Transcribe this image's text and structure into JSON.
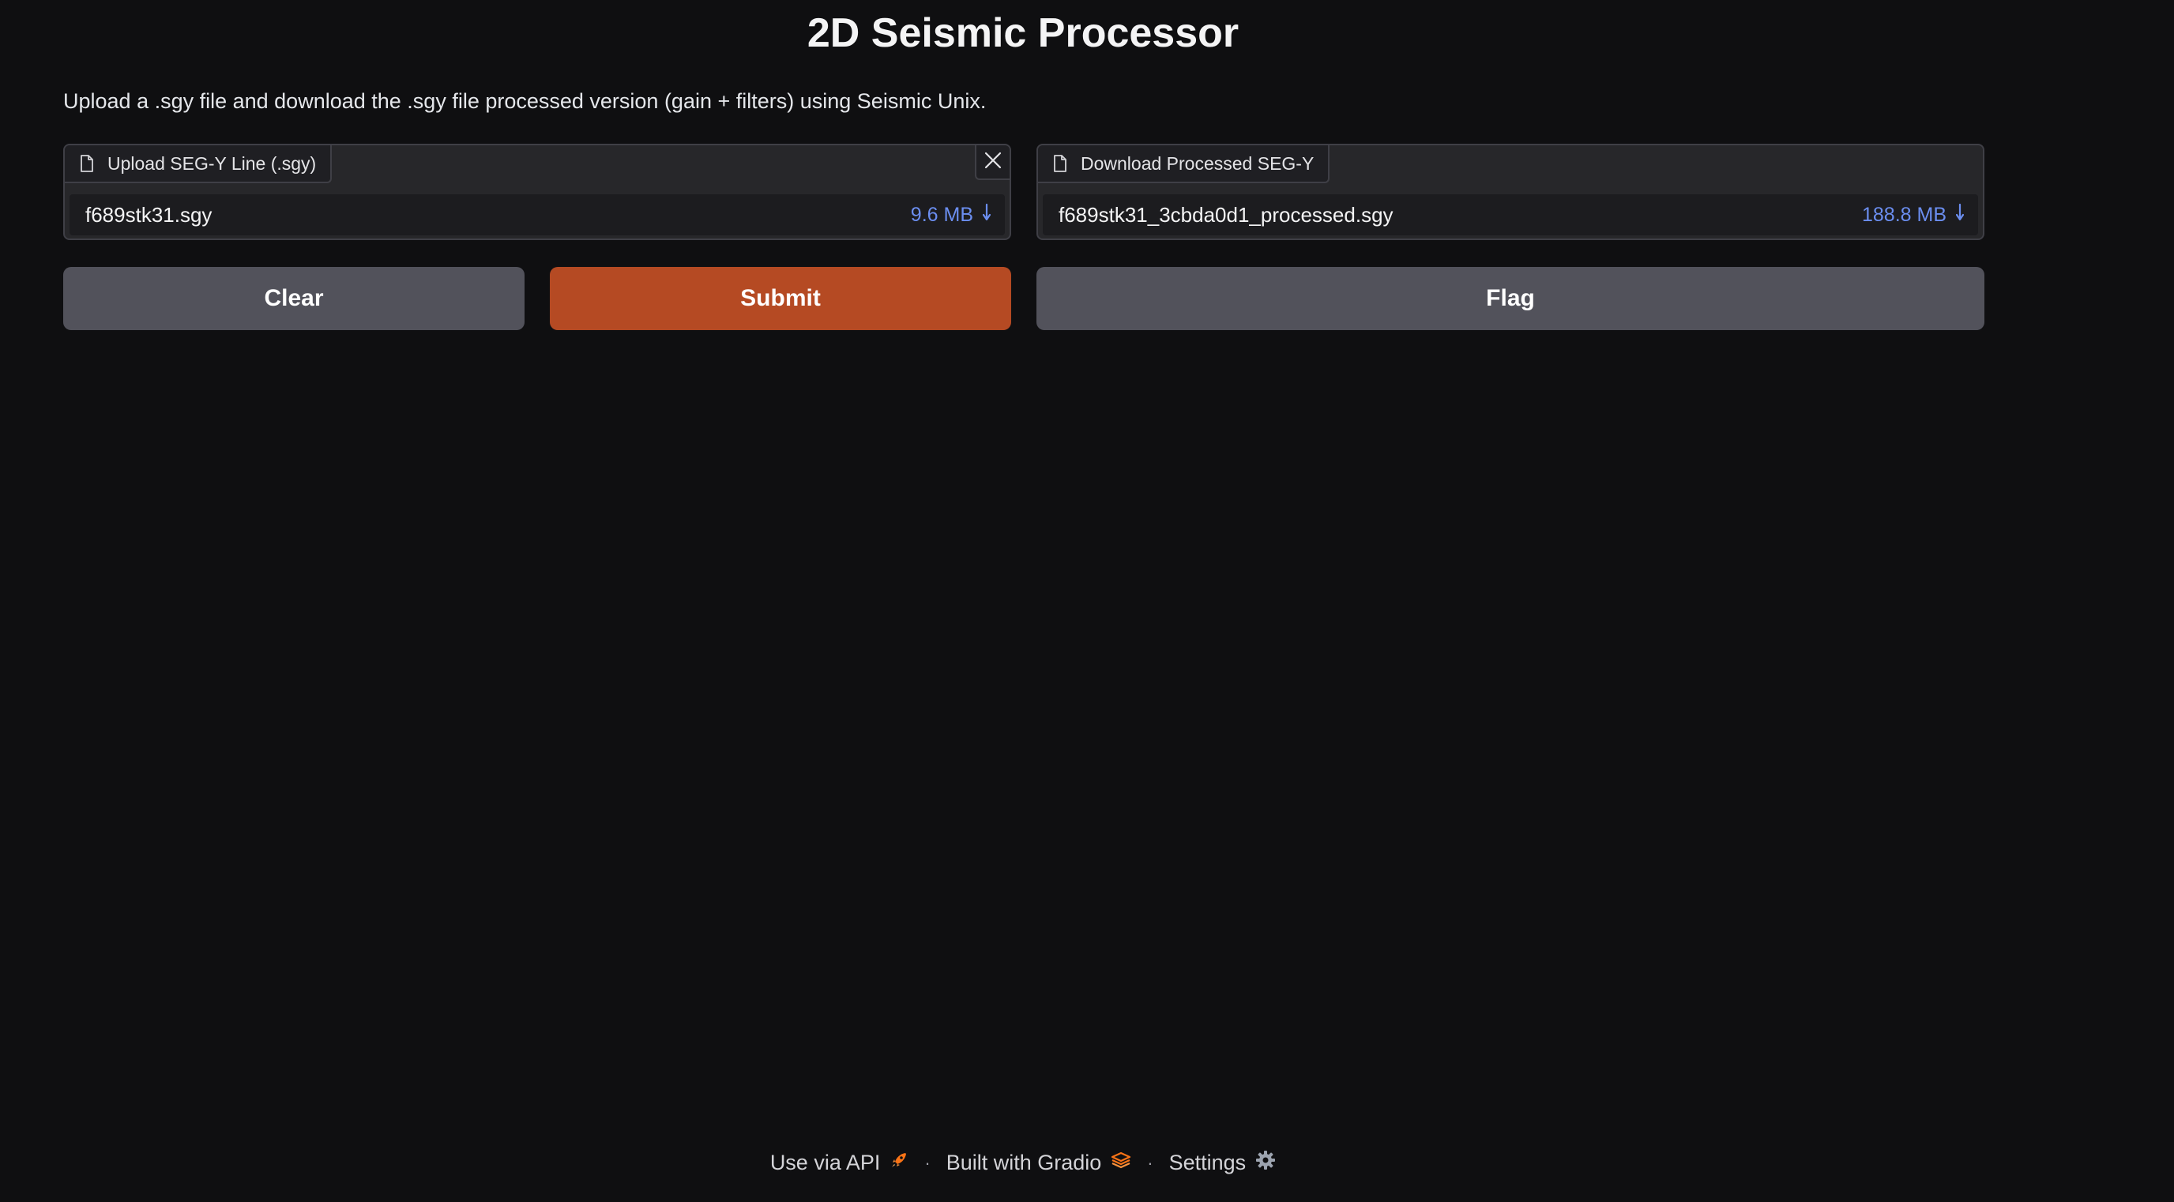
{
  "header": {
    "title": "2D Seismic Processor",
    "description": "Upload a .sgy file and download the .sgy file processed version (gain + filters) using Seismic Unix."
  },
  "upload": {
    "label": "Upload SEG-Y Line (.sgy)",
    "file_name": "f689stk31.sgy",
    "file_size": "9.6 MB"
  },
  "download": {
    "label": "Download Processed SEG-Y",
    "file_name": "f689stk31_3cbda0d1_processed.sgy",
    "file_size": "188.8 MB"
  },
  "buttons": {
    "clear": "Clear",
    "submit": "Submit",
    "flag": "Flag"
  },
  "footer": {
    "api": "Use via API",
    "built": "Built with Gradio",
    "settings": "Settings",
    "separator": "·"
  },
  "colors": {
    "background": "#0f0f11",
    "accent": "#b54a23",
    "file_size": "#6b8ef0",
    "gradio_logo": "#f97316"
  },
  "icons": {
    "file": "file-icon",
    "close": "close-icon",
    "download": "download-icon",
    "rocket": "rocket-icon",
    "gradio": "gradio-logo-icon",
    "settings": "gear-icon"
  }
}
